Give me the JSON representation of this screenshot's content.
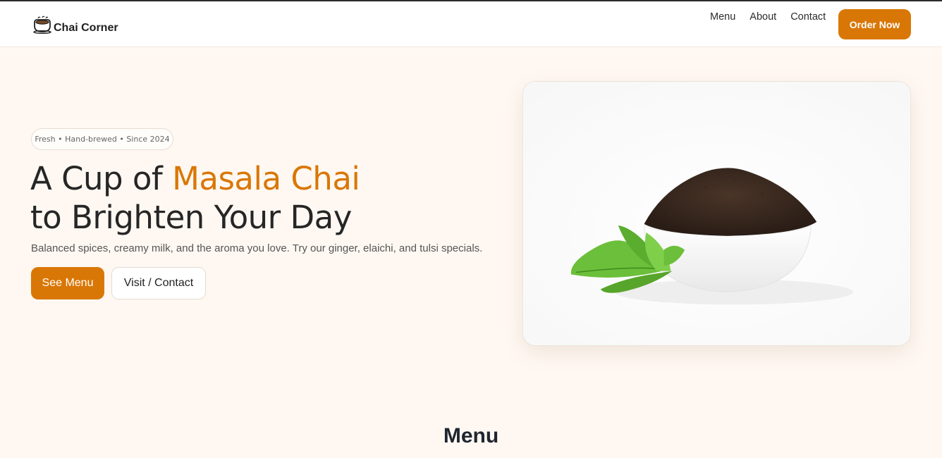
{
  "brand": {
    "name": "Chai Corner",
    "logo_icon": "chai-cup-icon"
  },
  "nav": {
    "links": [
      "Menu",
      "About",
      "Contact"
    ],
    "cta": "Order Now"
  },
  "hero": {
    "badge": "Fresh • Hand-brewed • Since 2024",
    "headline_part1": "A Cup of ",
    "headline_accent": "Masala Chai",
    "headline_line2": "to Brighten Your Day",
    "subtext": "Balanced spices, creamy milk, and the aroma you love. Try our ginger, elaichi, and tulsi specials.",
    "primary_button": "See Menu",
    "secondary_button": "Visit / Contact",
    "image_icon": "tea-bowl-with-mint-image"
  },
  "section": {
    "title": "Menu"
  },
  "colors": {
    "accent": "#d97706",
    "background": "#fff8f2",
    "text": "#262626"
  }
}
